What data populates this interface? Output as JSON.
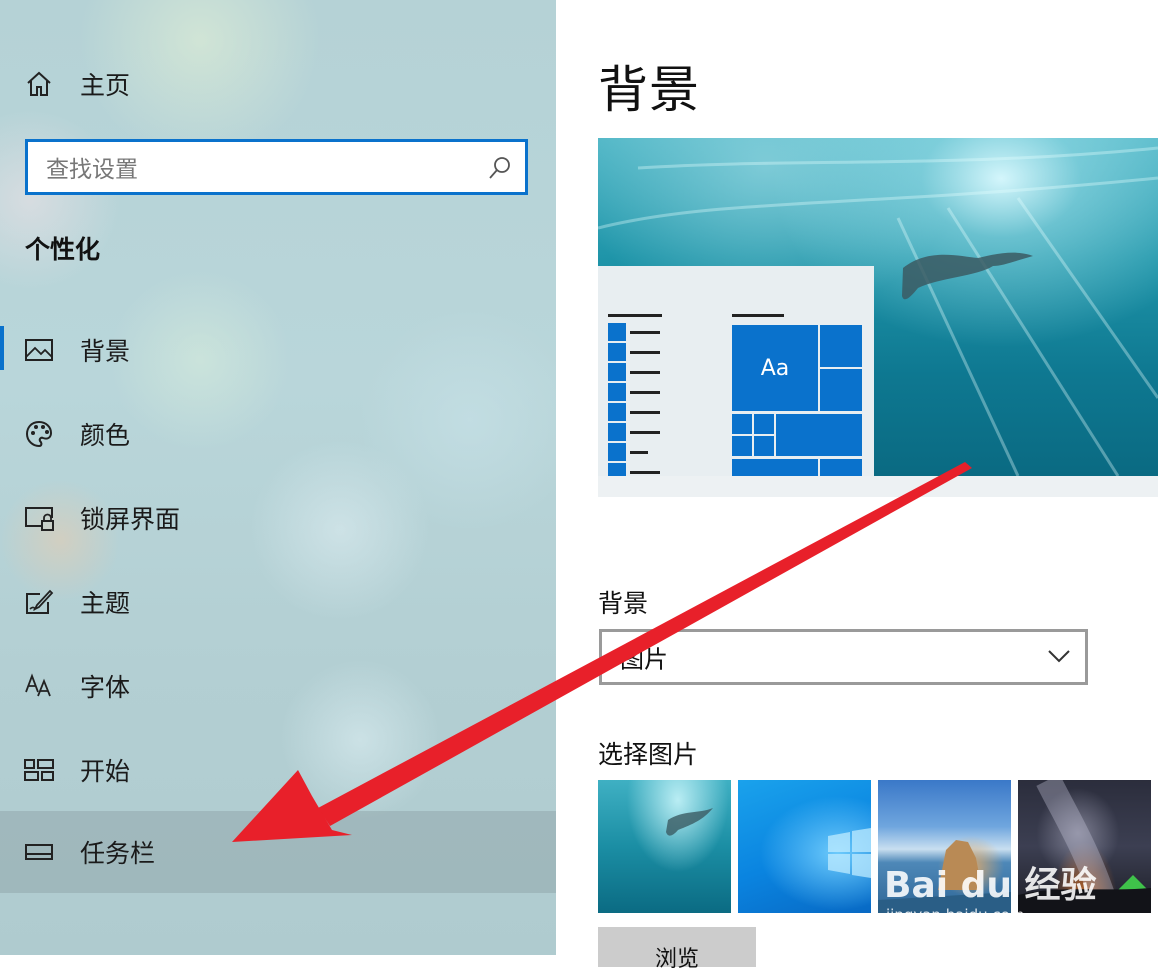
{
  "sidebar": {
    "home_label": "主页",
    "search_placeholder": "查找设置",
    "section_title": "个性化",
    "items": [
      {
        "label": "背景",
        "icon": "picture-icon",
        "active": true
      },
      {
        "label": "颜色",
        "icon": "palette-icon"
      },
      {
        "label": "锁屏界面",
        "icon": "lock-screen-icon"
      },
      {
        "label": "主题",
        "icon": "theme-icon"
      },
      {
        "label": "字体",
        "icon": "font-icon"
      },
      {
        "label": "开始",
        "icon": "start-icon"
      },
      {
        "label": "任务栏",
        "icon": "taskbar-icon",
        "hovered": true
      }
    ]
  },
  "main": {
    "title": "背景",
    "preview": {
      "sample_text": "Aa"
    },
    "background_label": "背景",
    "background_select_value": "图片",
    "choose_picture_label": "选择图片",
    "browse_label": "浏览"
  },
  "watermark": {
    "text": "Bai du 经验",
    "url": "jingyan.baidu.com"
  },
  "colors": {
    "accent": "#0a72cc",
    "annotation_arrow": "#e8202a"
  }
}
